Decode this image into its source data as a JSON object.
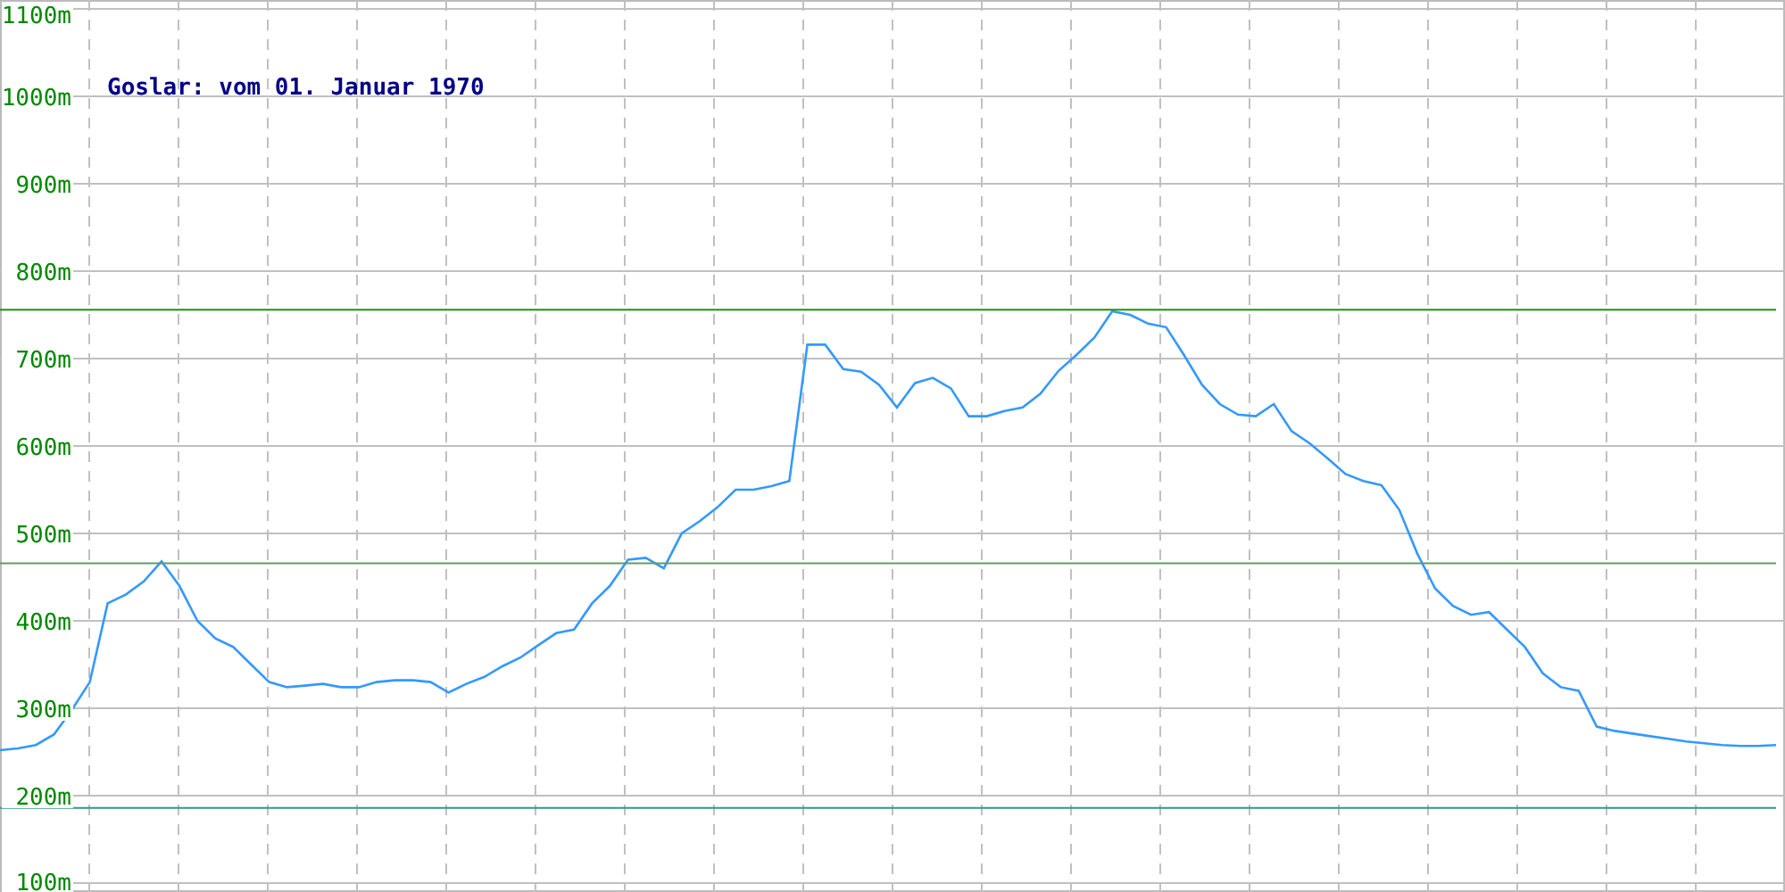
{
  "chart": {
    "chart_data": {
      "type": "line",
      "title": "Goslar: vom 01. Januar 1970",
      "grid": true,
      "series": [
        {
          "color": "#3399ff",
          "values": [
            252,
            254,
            258,
            270,
            298,
            330,
            420,
            430,
            445,
            468,
            440,
            400,
            380,
            370,
            350,
            330,
            324,
            326,
            328,
            324,
            324,
            330,
            332,
            332,
            330,
            318,
            328,
            336,
            348,
            358,
            372,
            386,
            390,
            420,
            440,
            470,
            472,
            460,
            500,
            514,
            530,
            550,
            550,
            554,
            560,
            716,
            716,
            688,
            685,
            670,
            644,
            672,
            678,
            666,
            634,
            634,
            640,
            644,
            660,
            686,
            704,
            724,
            754,
            750,
            740,
            736,
            704,
            670,
            648,
            636,
            634,
            648,
            617,
            603,
            586,
            568,
            560,
            555,
            527,
            477,
            437,
            417,
            407,
            410,
            390,
            370,
            340,
            324,
            320,
            279,
            274,
            271,
            268,
            265,
            262,
            260,
            258,
            257,
            257,
            258
          ]
        },
        {
          "color": "#119911",
          "values": [
            756,
            756,
            756,
            756,
            756,
            756,
            756,
            756,
            756,
            756,
            756,
            756,
            756,
            756,
            756,
            756,
            756,
            756,
            756,
            756,
            756,
            756,
            756,
            756,
            756,
            756,
            756,
            756,
            756,
            756,
            756,
            756,
            756,
            756,
            756,
            756,
            756,
            756,
            756,
            756,
            756,
            756,
            756,
            756,
            756,
            756,
            756,
            756,
            756,
            756,
            756,
            756,
            756,
            756,
            756,
            756,
            756,
            756,
            756,
            756,
            756,
            756,
            756,
            756,
            756,
            756,
            756,
            756,
            756,
            756,
            756,
            756,
            756,
            756,
            756,
            756,
            756,
            756,
            756,
            756,
            756,
            756,
            756,
            756,
            756,
            756,
            756,
            756,
            756,
            756,
            756,
            756,
            756,
            756,
            756,
            756,
            756,
            756,
            756,
            756
          ]
        },
        {
          "color": "#669966",
          "values": [
            466,
            466,
            466,
            466,
            466,
            466,
            466,
            466,
            466,
            466,
            466,
            466,
            466,
            466,
            466,
            466,
            466,
            466,
            466,
            466,
            466,
            466,
            466,
            466,
            466,
            466,
            466,
            466,
            466,
            466,
            466,
            466,
            466,
            466,
            466,
            466,
            466,
            466,
            466,
            466,
            466,
            466,
            466,
            466,
            466,
            466,
            466,
            466,
            466,
            466,
            466,
            466,
            466,
            466,
            466,
            466,
            466,
            466,
            466,
            466,
            466,
            466,
            466,
            466,
            466,
            466,
            466,
            466,
            466,
            466,
            466,
            466,
            466,
            466,
            466,
            466,
            466,
            466,
            466,
            466,
            466,
            466,
            466,
            466,
            466,
            466,
            466,
            466,
            466,
            466,
            466,
            466,
            466,
            466,
            466,
            466,
            466,
            466,
            466,
            466
          ]
        },
        {
          "color": "#339988",
          "values": [
            186,
            186,
            186,
            186,
            186,
            186,
            186,
            186,
            186,
            186,
            186,
            186,
            186,
            186,
            186,
            186,
            186,
            186,
            186,
            186,
            186,
            186,
            186,
            186,
            186,
            186,
            186,
            186,
            186,
            186,
            186,
            186,
            186,
            186,
            186,
            186,
            186,
            186,
            186,
            186,
            186,
            186,
            186,
            186,
            186,
            186,
            186,
            186,
            186,
            186,
            186,
            186,
            186,
            186,
            186,
            186,
            186,
            186,
            186,
            186,
            186,
            186,
            186,
            186,
            186,
            186,
            186,
            186,
            186,
            186,
            186,
            186,
            186,
            186,
            186,
            186,
            186,
            186,
            186,
            186,
            186,
            186,
            186,
            186,
            186,
            186,
            186,
            186,
            186,
            186,
            186,
            186,
            186,
            186,
            186,
            186,
            186,
            186,
            186,
            186
          ]
        }
      ],
      "ylim": [
        100,
        1100
      ],
      "yticks": [
        {
          "value": 100,
          "label": "100m"
        },
        {
          "value": 200,
          "label": "200m"
        },
        {
          "value": 300,
          "label": "300m"
        },
        {
          "value": 400,
          "label": "400m"
        },
        {
          "value": 500,
          "label": "500m"
        },
        {
          "value": 600,
          "label": "600m"
        },
        {
          "value": 700,
          "label": "700m"
        },
        {
          "value": 800,
          "label": "800m"
        },
        {
          "value": 900,
          "label": "900m"
        },
        {
          "value": 1000,
          "label": "1000m"
        },
        {
          "value": 1100,
          "label": "1100m"
        }
      ]
    }
  }
}
